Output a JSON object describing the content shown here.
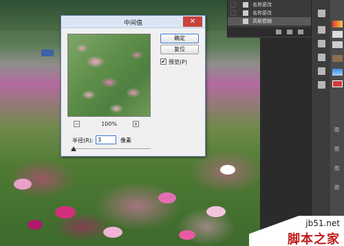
{
  "dialog": {
    "title": "中间值",
    "close_label": "✕",
    "ok_label": "确定",
    "reset_label": "复位",
    "preview_label": "预览(P)",
    "preview_checked": true,
    "zoom_level": "100%",
    "zoom_minus": "−",
    "zoom_plus": "+",
    "radius_label": "半径(R):",
    "radius_value": "3",
    "radius_unit": "像素"
  },
  "layers_panel": {
    "rows": [
      {
        "name": "名称更改"
      },
      {
        "name": "名称更改"
      },
      {
        "name": "高斯模糊"
      }
    ]
  },
  "watermark": {
    "url": "jb51.net",
    "text": "脚本之家"
  },
  "side_chars": [
    "图",
    "图",
    "图",
    "图"
  ]
}
